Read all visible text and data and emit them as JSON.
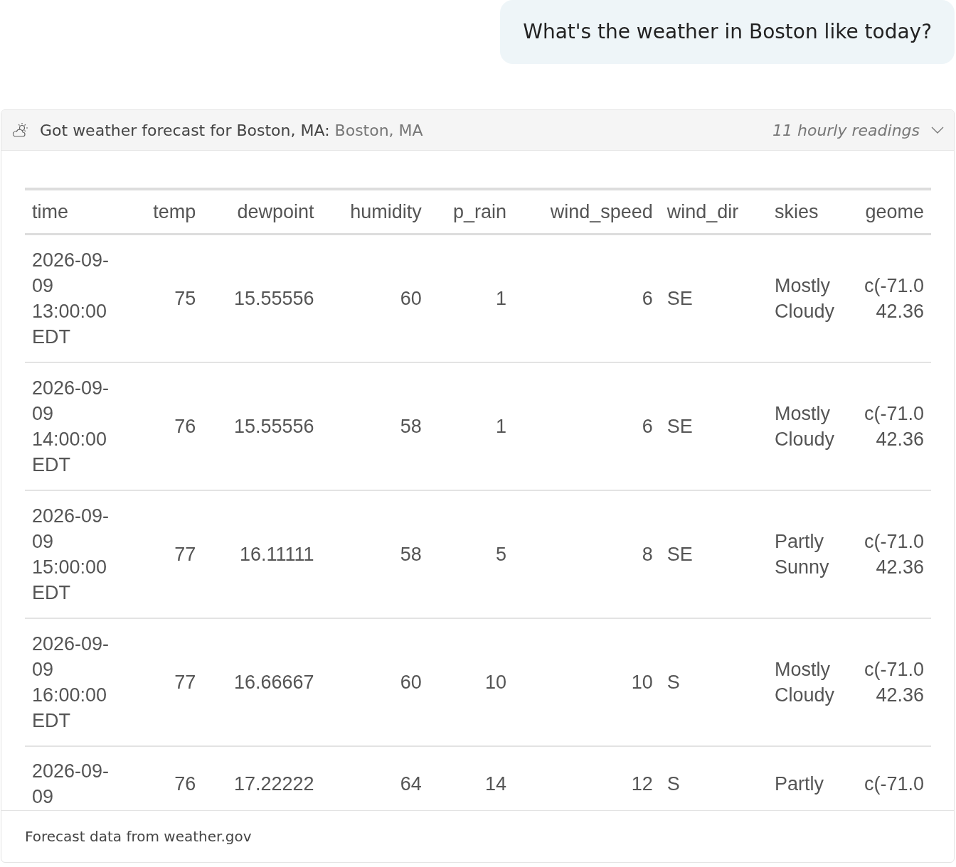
{
  "user_message": "What's the weather in Boston like today?",
  "tool_card": {
    "title": "Got weather forecast for Boston, MA:",
    "subtitle": "Boston, MA",
    "summary": "11 hourly readings",
    "expanded": true,
    "footer": "Forecast data from weather.gov"
  },
  "table": {
    "columns": [
      {
        "label": "time",
        "kind": "text"
      },
      {
        "label": "temp",
        "kind": "number"
      },
      {
        "label": "dewpoint",
        "kind": "number"
      },
      {
        "label": "humidity",
        "kind": "number"
      },
      {
        "label": "p_rain",
        "kind": "number"
      },
      {
        "label": "wind_speed",
        "kind": "number"
      },
      {
        "label": "wind_dir",
        "kind": "text"
      },
      {
        "label": "skies",
        "kind": "text"
      },
      {
        "label": "geome",
        "kind": "number"
      }
    ],
    "rows": [
      [
        "2026-09-09 13:00:00 EDT",
        "75",
        "15.55556",
        "60",
        "1",
        "6",
        "SE",
        "Mostly Cloudy",
        "c(-71.0 42.36"
      ],
      [
        "2026-09-09 14:00:00 EDT",
        "76",
        "15.55556",
        "58",
        "1",
        "6",
        "SE",
        "Mostly Cloudy",
        "c(-71.0 42.36"
      ],
      [
        "2026-09-09 15:00:00 EDT",
        "77",
        "16.11111",
        "58",
        "5",
        "8",
        "SE",
        "Partly Sunny",
        "c(-71.0 42.36"
      ],
      [
        "2026-09-09 16:00:00 EDT",
        "77",
        "16.66667",
        "60",
        "10",
        "10",
        "S",
        "Mostly Cloudy",
        "c(-71.0 42.36"
      ],
      [
        "2026-09-09",
        "76",
        "17.22222",
        "64",
        "14",
        "12",
        "S",
        "Partly",
        "c(-71.0"
      ]
    ]
  }
}
